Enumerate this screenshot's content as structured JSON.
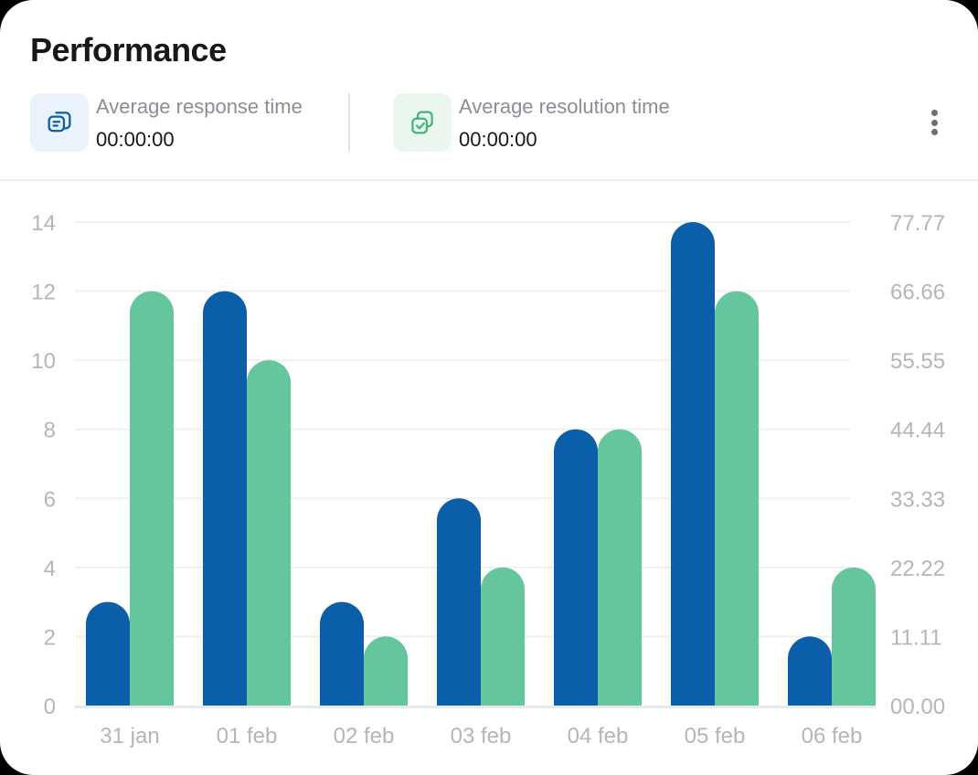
{
  "header": {
    "title": "Performance",
    "stats": [
      {
        "label": "Average response time",
        "value": "00:00:00",
        "icon": "chat-bubbles-icon",
        "bg": "#eaf3fc",
        "color": "#0b5ea8"
      },
      {
        "label": "Average resolution time",
        "value": "00:00:00",
        "icon": "squares-check-icon",
        "bg": "#e9f7ef",
        "color": "#47b27b"
      }
    ],
    "menu_icon": "more-vertical-icon"
  },
  "chart_data": {
    "type": "bar",
    "categories": [
      "31 jan",
      "01 feb",
      "02 feb",
      "03 feb",
      "04 feb",
      "05 feb",
      "06 feb"
    ],
    "series": [
      {
        "axis": "left",
        "color": "#0b5ea8",
        "values": [
          3,
          12,
          3,
          6,
          8,
          14,
          2
        ]
      },
      {
        "axis": "right",
        "color": "#65c59c",
        "values": [
          66.66,
          55.55,
          11.11,
          22.22,
          44.44,
          66.66,
          22.22
        ]
      }
    ],
    "y_left": {
      "ticks": [
        "0",
        "2",
        "4",
        "6",
        "8",
        "10",
        "12",
        "14"
      ],
      "lim": [
        0,
        14
      ]
    },
    "y_right": {
      "ticks": [
        "00.00",
        "11.11",
        "22.22",
        "33.33",
        "44.44",
        "55.55",
        "66.66",
        "77.77"
      ],
      "lim": [
        0,
        77.77
      ]
    },
    "grid": true,
    "legend": "none"
  }
}
